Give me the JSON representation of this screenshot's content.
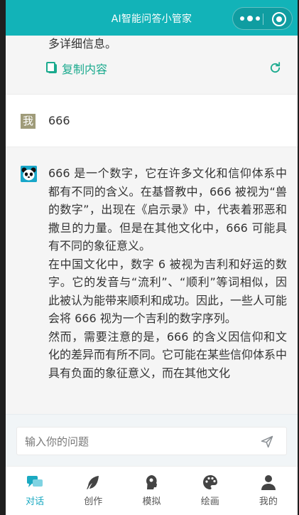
{
  "header": {
    "title": "AI智能问答小管家"
  },
  "chat": {
    "prev_answer_tail": "多详细信息。",
    "copy_label": "复制内容",
    "user_avatar_text": "我",
    "user_message": "666",
    "ai_answer": [
      "666 是一个数字，它在许多文化和信仰体系中都有不同的含义。在基督教中，666 被视为“兽的数字”，出现在《启示录》中，代表着邪恶和撒旦的力量。但是在其他文化中，666 可能具有不同的象征意义。",
      "在中国文化中，数字 6 被视为吉利和好运的数字。它的发音与“流利”、“顺利”等词相似，因此被认为能带来顺利和成功。因此，一些人可能会将 666 视为一个吉利的数字序列。",
      "然而，需要注意的是，666 的含义因信仰和文化的差异而有所不同。它可能在某些信仰体系中具有负面的象征意义，而在其他文化"
    ]
  },
  "input": {
    "placeholder": "输入你的问题"
  },
  "tabs": [
    {
      "label": "对话",
      "icon": "chat-icon",
      "active": true
    },
    {
      "label": "创作",
      "icon": "feather-icon",
      "active": false
    },
    {
      "label": "模拟",
      "icon": "head-icon",
      "active": false
    },
    {
      "label": "绘画",
      "icon": "palette-icon",
      "active": false
    },
    {
      "label": "我的",
      "icon": "user-icon",
      "active": false
    }
  ],
  "colors": {
    "header": "#12b3b8",
    "accent": "#1aaa8e",
    "tab_active": "#1aa9c1"
  }
}
